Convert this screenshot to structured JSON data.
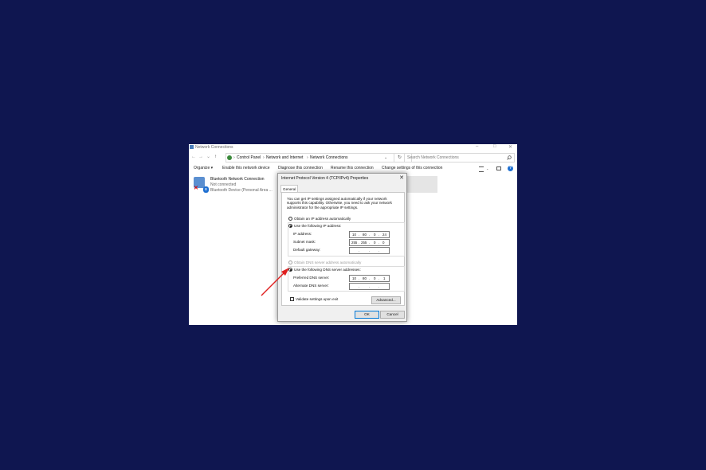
{
  "window": {
    "title": "Network Connections",
    "nav": {
      "back": "←",
      "forward": "→",
      "down": "⌄",
      "up": "↑",
      "refresh": "↻",
      "dropdown": "⌄"
    },
    "breadcrumb": [
      "Control Panel",
      "Network and Internet",
      "Network Connections"
    ],
    "breadcrumb_sep": "›",
    "search_placeholder": "Search Network Connections",
    "controls": {
      "minimize": "–",
      "maximize": "□",
      "close": "✕"
    },
    "toolbar": {
      "organize": "Organize ▾",
      "enable": "Enable this network device",
      "diagnose": "Diagnose this connection",
      "rename": "Rename this connection",
      "change": "Change settings of this connection"
    },
    "help": "?",
    "connection": {
      "name": "Bluetooth Network Connection",
      "status": "Not connected",
      "device": "Bluetooth Device (Personal Area ..."
    }
  },
  "dialog": {
    "title": "Internet Protocol Version 4 (TCP/IPv4) Properties",
    "close": "✕",
    "tab": "General",
    "description": "You can get IP settings assigned automatically if your network supports this capability. Otherwise, you need to ask your network administrator for the appropriate IP settings.",
    "ip_auto_label": "Obtain an IP address automatically",
    "ip_manual_label": "Use the following IP address:",
    "ip_address_label": "IP address:",
    "ip_address": [
      "10",
      "80",
      "0",
      "24"
    ],
    "subnet_label": "Subnet mask:",
    "subnet": [
      "255",
      "255",
      "0",
      "0"
    ],
    "gateway_label": "Default gateway:",
    "dns_auto_label": "Obtain DNS server address automatically",
    "dns_manual_label": "Use the following DNS server addresses:",
    "preferred_dns_label": "Preferred DNS server:",
    "preferred_dns": [
      "10",
      "80",
      "0",
      "1"
    ],
    "alternate_dns_label": "Alternate DNS server:",
    "validate_label": "Validate settings upon exit",
    "advanced_button": "Advanced...",
    "ok_button": "OK",
    "cancel_button": "Cancel"
  },
  "colors": {
    "background": "#0f1650",
    "arrow": "#e02020",
    "accent": "#0078d7"
  }
}
